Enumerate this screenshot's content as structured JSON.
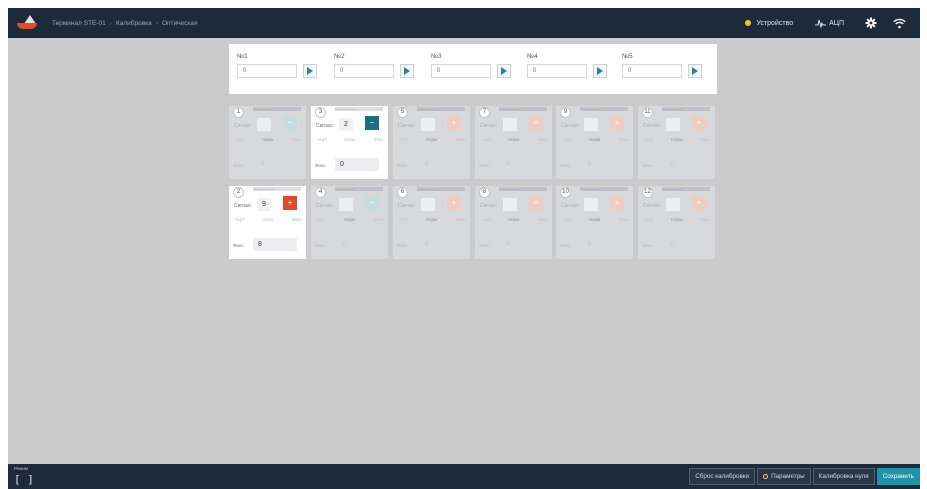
{
  "breadcrumb": [
    "Терминал STE-01",
    "Калибровка",
    "Оптическая"
  ],
  "header": {
    "device_label": "Устройство",
    "device_status_color": "#f3c623",
    "adc_label": "АЦП",
    "icons": [
      "boat-logo-icon",
      "pulse-icon",
      "gear-icon",
      "wifi-icon"
    ]
  },
  "np_inputs": [
    {
      "label": "№1",
      "value": "0"
    },
    {
      "label": "№2",
      "value": "0"
    },
    {
      "label": "№3",
      "value": "0"
    },
    {
      "label": "№4",
      "value": "0"
    },
    {
      "label": "№5",
      "value": "0"
    }
  ],
  "channel_labels": {
    "signal": "Сигнал",
    "modes": [
      "АЦП",
      "Норм.",
      "Фикс."
    ],
    "value": "Фикс."
  },
  "channels": [
    {
      "num": "1",
      "tag": "——————",
      "signal": "",
      "sign": "−",
      "value": "0",
      "active": false
    },
    {
      "num": "3",
      "tag": "——————",
      "signal": "2",
      "sign": "−",
      "value": "0",
      "active": true
    },
    {
      "num": "5",
      "tag": "——————",
      "signal": "",
      "sign": "+",
      "value": "0",
      "active": false
    },
    {
      "num": "7",
      "tag": "——————",
      "signal": "",
      "sign": "+",
      "value": "0",
      "active": false
    },
    {
      "num": "9",
      "tag": "——————",
      "signal": "",
      "sign": "+",
      "value": "0",
      "active": false
    },
    {
      "num": "11",
      "tag": "——————",
      "signal": "",
      "sign": "+",
      "value": "0",
      "active": false
    },
    {
      "num": "2",
      "tag": "——————",
      "signal": "9",
      "sign": "+",
      "value": "8",
      "active": true
    },
    {
      "num": "4",
      "tag": "——————",
      "signal": "",
      "sign": "−",
      "value": "0",
      "active": false
    },
    {
      "num": "6",
      "tag": "——————",
      "signal": "",
      "sign": "+",
      "value": "0",
      "active": false
    },
    {
      "num": "8",
      "tag": "——————",
      "signal": "",
      "sign": "+",
      "value": "0",
      "active": false
    },
    {
      "num": "10",
      "tag": "——————",
      "signal": "",
      "sign": "+",
      "value": "0",
      "active": false
    },
    {
      "num": "12",
      "tag": "——————",
      "signal": "",
      "sign": "+",
      "value": "0",
      "active": false
    }
  ],
  "footer": {
    "mode_label": "Режим",
    "mode_value": "[ ]",
    "buttons": {
      "reset": "Сброс калибровки",
      "params": "Параметры",
      "zero": "Калибровка нуля",
      "save": "Сохранить"
    }
  },
  "colors": {
    "topbar": "#1d2a3a",
    "accent_teal": "#1d6f80",
    "accent_red": "#e0492a",
    "save_button": "#1f93a8"
  }
}
